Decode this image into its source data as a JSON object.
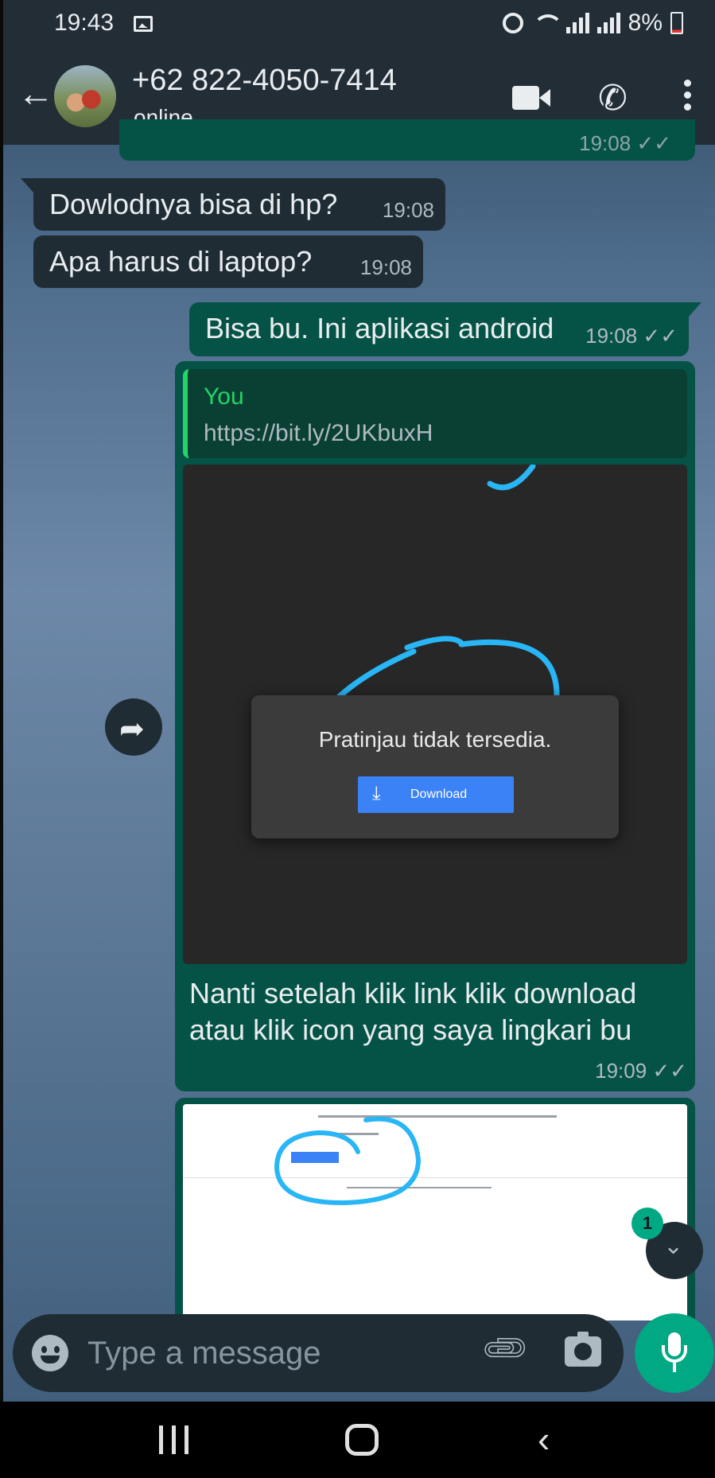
{
  "status_bar": {
    "time": "19:43",
    "battery": "8%",
    "icons": [
      "gallery-icon",
      "alarm-icon",
      "wifi-icon",
      "signal-icon",
      "battery-icon"
    ]
  },
  "header": {
    "contact_name": "+62 822-4050-7414",
    "status": "online",
    "icons": [
      "back-arrow-icon",
      "video-call-icon",
      "voice-call-icon",
      "more-options-icon"
    ]
  },
  "messages": [
    {
      "type": "out",
      "partial": true,
      "time": "19:08 ✓✓"
    },
    {
      "type": "in",
      "text": "Dowlodnya bisa di hp?",
      "time": "19:08"
    },
    {
      "type": "in",
      "text": "Apa harus di laptop?",
      "time": "19:08"
    },
    {
      "type": "out",
      "text": "Bisa bu. Ini aplikasi android",
      "time": "19:08 ✓✓"
    },
    {
      "type": "out",
      "quote": {
        "author": "You",
        "text": "https://bit.ly/2UKbuxH"
      },
      "preview": {
        "text": "Pratinjau tidak tersedia.",
        "button": "Download"
      },
      "caption": "Nanti setelah klik link klik download atau klik icon yang saya lingkari bu",
      "time": "19:09 ✓✓"
    },
    {
      "type": "out",
      "partial": true,
      "image": "screenshot"
    }
  ],
  "unread_count": "1",
  "composer": {
    "placeholder": "Type a message"
  },
  "accent_colors": {
    "header": "#232d36",
    "outgoing": "#055346",
    "incoming": "#1f2c34",
    "green": "#00a884",
    "circle": "#29b6f6"
  }
}
